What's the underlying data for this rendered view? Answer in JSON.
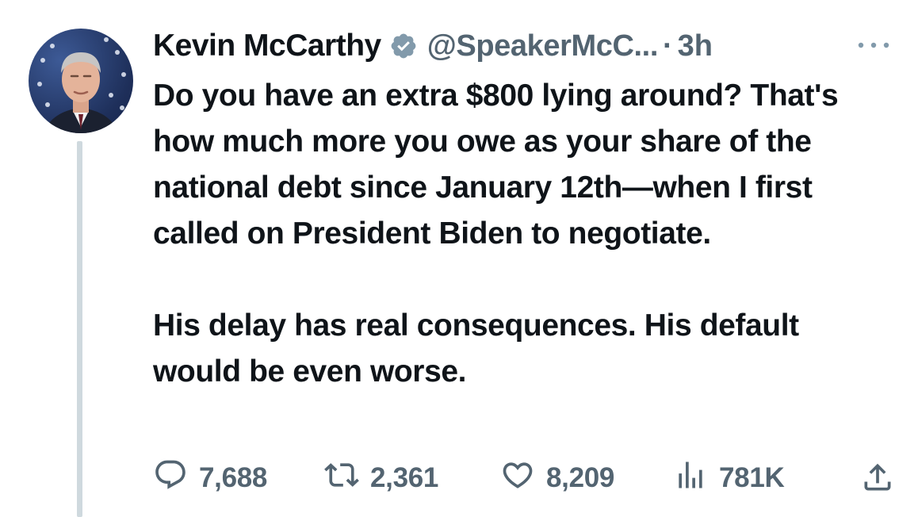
{
  "author": {
    "name": "Kevin McCarthy",
    "handle": "@SpeakerMcC...",
    "separator": "·",
    "time": "3h"
  },
  "tweet": {
    "paragraphs": [
      "Do you have an extra $800 lying around? That's how much more you owe as your share of the national debt since January 12th—when I first called on President Biden to negotiate.",
      "His delay has real consequences. His default would be even worse."
    ]
  },
  "actions": {
    "replies": "7,688",
    "retweets": "2,361",
    "likes": "8,209",
    "views": "781K"
  },
  "icons": {
    "verified": "verified-badge-icon",
    "more": "more-options-icon",
    "reply": "reply-icon",
    "retweet": "retweet-icon",
    "like": "heart-icon",
    "views": "analytics-icon",
    "share": "share-icon"
  },
  "colors": {
    "text": "#0f1419",
    "muted": "#536471",
    "verified": "#829aab",
    "thread_line": "#cfd9de"
  }
}
